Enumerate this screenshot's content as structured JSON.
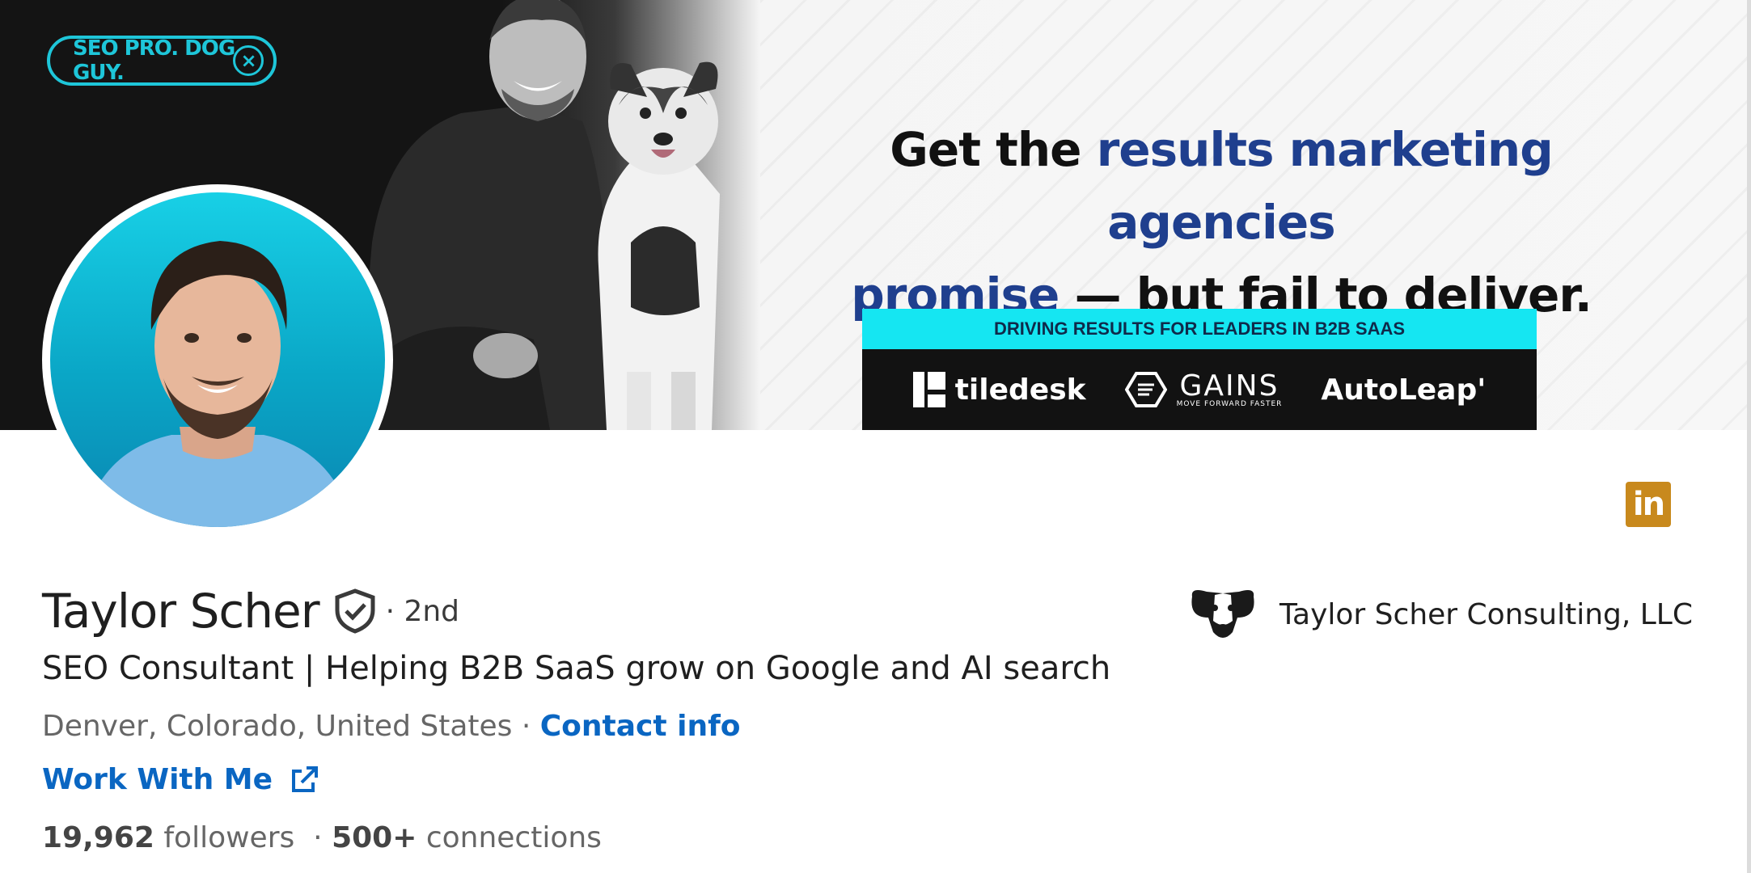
{
  "banner": {
    "badge": "SEO PRO. DOG GUY.",
    "badge_close": "×",
    "headline_part1": "Get the ",
    "headline_blue1": "results marketing agencies",
    "headline_blue2": "promise",
    "headline_part2": " — but fail to deliver.",
    "driving_text": "DRIVING RESULTS FOR LEADERS IN B2B SAAS",
    "logos": [
      "tiledesk",
      "GAINS",
      "AutoLeap'"
    ],
    "gains_tagline": "MOVE FORWARD FASTER",
    "accent_color": "#15e6f2",
    "headline_blue_color": "#1f3f8e"
  },
  "profile": {
    "name": "Taylor Scher",
    "degree": "· 2nd",
    "headline": "SEO Consultant | Helping B2B SaaS grow on Google and AI search",
    "location": "Denver, Colorado, United States",
    "location_sep": " · ",
    "contact_info": "Contact info",
    "work_link": "Work With Me",
    "followers_count": "19,962",
    "followers_label": "followers",
    "connections_sep": "·",
    "connections_count": "500+",
    "connections_label": "connections"
  },
  "company": {
    "name": "Taylor Scher Consulting, LLC",
    "logo_icon": "dog-logo-icon"
  },
  "linkedin_icon": "in",
  "colors": {
    "link": "#0a66c2",
    "linkedin_badge": "#c8891d"
  }
}
